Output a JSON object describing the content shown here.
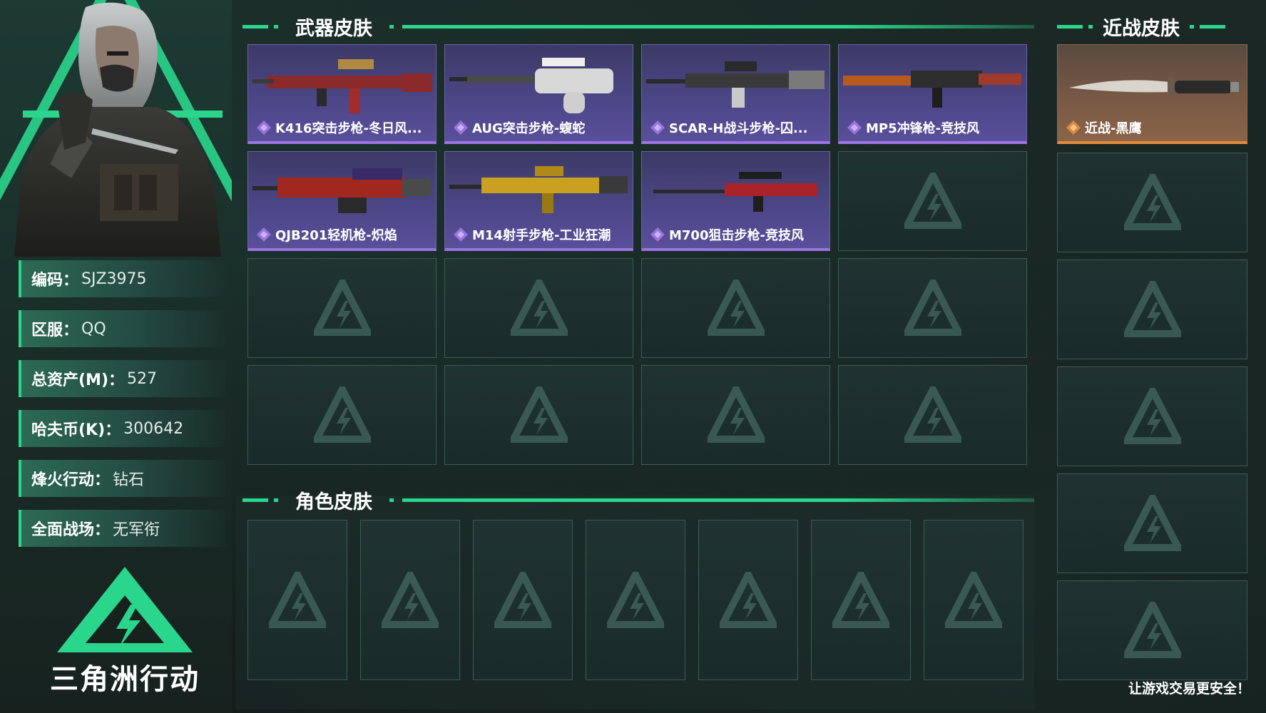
{
  "profile": {
    "rows": [
      {
        "key": "编码：",
        "value": "SJZ3975"
      },
      {
        "key": "区服：",
        "value": "QQ"
      },
      {
        "key": "总资产(M)：",
        "value": "527"
      },
      {
        "key": "哈夫币(K)：",
        "value": "300642"
      },
      {
        "key": "烽火行动：",
        "value": "钻石"
      },
      {
        "key": "全面战场：",
        "value": "无军衔"
      }
    ]
  },
  "logo": {
    "text": "三角洲行动"
  },
  "weapon_section": {
    "title": "武器皮肤",
    "items": [
      {
        "label": "K416突击步枪-冬日风...",
        "icon": "rifle-icon"
      },
      {
        "label": "AUG突击步枪-蝮蛇",
        "icon": "rifle-icon"
      },
      {
        "label": "SCAR-H战斗步枪-囚...",
        "icon": "rifle-icon"
      },
      {
        "label": "MP5冲锋枪-竞技风",
        "icon": "smg-icon"
      },
      {
        "label": "QJB201轻机枪-炽焰",
        "icon": "lmg-icon"
      },
      {
        "label": "M14射手步枪-工业狂潮",
        "icon": "rifle-icon"
      },
      {
        "label": "M700狙击步枪-竞技风",
        "icon": "sniper-icon"
      }
    ]
  },
  "melee_section": {
    "title": "近战皮肤",
    "items": [
      {
        "label": "近战-黑鹰",
        "icon": "knife-icon"
      }
    ]
  },
  "character_section": {
    "title": "角色皮肤"
  },
  "footer": {
    "slogan": "让游戏交易更安全！"
  },
  "colors": {
    "accent": "#2ad68c",
    "epic": "#9a74e0",
    "legend": "#e08a3a"
  }
}
